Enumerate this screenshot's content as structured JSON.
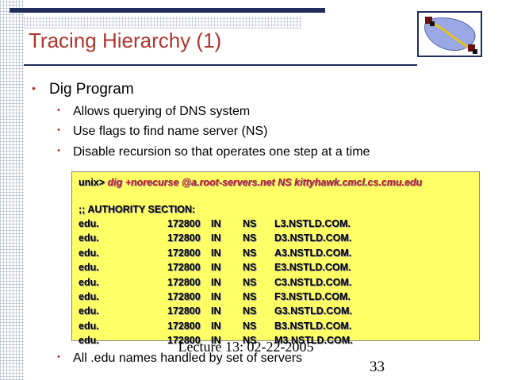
{
  "slide": {
    "title": "Tracing Hierarchy (1)",
    "bullet": "Dig Program",
    "sub_bullets": [
      "Allows querying of DNS system",
      "Use flags to find name server (NS)",
      "Disable recursion so that operates one step at a time"
    ],
    "last_bullet": "All .edu names handled by set of servers",
    "bullet_glyph": "•",
    "footer": {
      "lecture": "Lecture 13: 02-22-2005",
      "page_number": "33"
    }
  },
  "terminal": {
    "prompt": "unix>",
    "command": "dig +norecurse @a.root-servers.net NS kittyhawk.cmcl.cs.cmu.edu",
    "section_header": ";; AUTHORITY SECTION:",
    "records": [
      [
        "edu.",
        "172800",
        "IN",
        "NS",
        "L3.NSTLD.COM."
      ],
      [
        "edu.",
        "172800",
        "IN",
        "NS",
        "D3.NSTLD.COM."
      ],
      [
        "edu.",
        "172800",
        "IN",
        "NS",
        "A3.NSTLD.COM."
      ],
      [
        "edu.",
        "172800",
        "IN",
        "NS",
        "E3.NSTLD.COM."
      ],
      [
        "edu.",
        "172800",
        "IN",
        "NS",
        "C3.NSTLD.COM."
      ],
      [
        "edu.",
        "172800",
        "IN",
        "NS",
        "F3.NSTLD.COM."
      ],
      [
        "edu.",
        "172800",
        "IN",
        "NS",
        "G3.NSTLD.COM."
      ],
      [
        "edu.",
        "172800",
        "IN",
        "NS",
        "B3.NSTLD.COM."
      ],
      [
        "edu.",
        "172800",
        "IN",
        "NS",
        "M3.NSTLD.COM."
      ]
    ]
  },
  "colors": {
    "title": "#b0352e",
    "accent_bar": "#1f2d5c",
    "code_background": "#ffff66",
    "command_args": "#c0172a"
  },
  "icons": [
    "network-logo-icon"
  ]
}
